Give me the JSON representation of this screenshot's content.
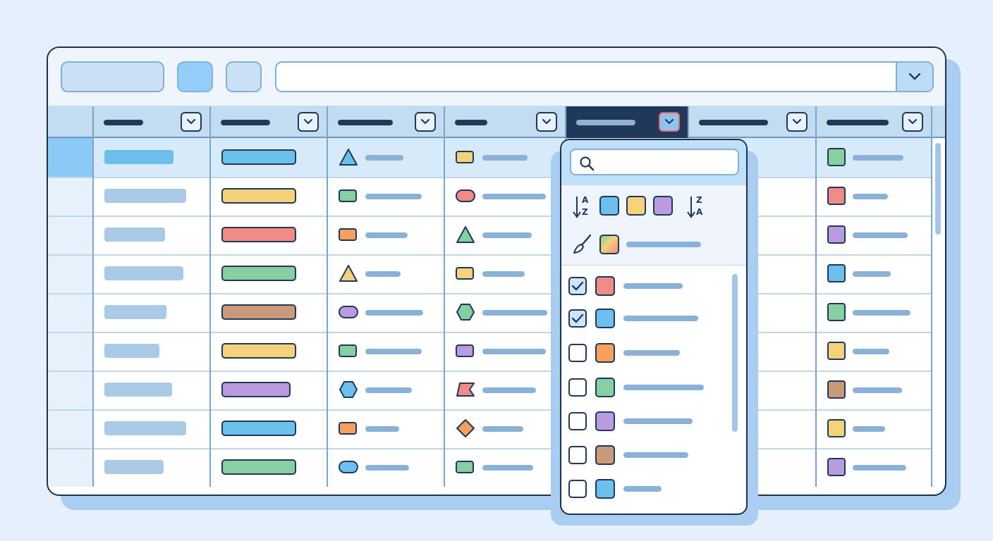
{
  "toolbar": {
    "buttons": [
      {
        "name": "toolbar-button-1"
      },
      {
        "name": "toolbar-button-2"
      },
      {
        "name": "toolbar-button-3"
      }
    ],
    "search_icon": "chevron-down-icon"
  },
  "columns": [
    {
      "name": "column-1",
      "dropdown_icon": "chevron-down-icon"
    },
    {
      "name": "column-2",
      "dropdown_icon": "chevron-down-icon"
    },
    {
      "name": "column-3",
      "dropdown_icon": "chevron-down-icon"
    },
    {
      "name": "column-4",
      "dropdown_icon": "chevron-down-icon"
    },
    {
      "name": "column-5",
      "dropdown_icon": "chevron-down-icon",
      "active": true
    },
    {
      "name": "column-6",
      "dropdown_icon": "chevron-down-icon"
    },
    {
      "name": "column-7",
      "dropdown_icon": "chevron-down-icon"
    }
  ],
  "colors": {
    "red": "#f08a86",
    "yellow": "#f4d27a",
    "green": "#86cfa3",
    "brown": "#c99a78",
    "purple": "#b99be0",
    "blue": "#6cc0ec",
    "orange": "#f8a05e",
    "selected_row": "#d6eaf9",
    "active_header": "#22385a",
    "accent": "#8ccaf5"
  },
  "rows": [
    {
      "selected": true,
      "tag": "blue",
      "c3": {
        "shape": "triangle",
        "color": "blue"
      },
      "c4": {
        "shape": "square",
        "color": "yellow"
      },
      "c7": "green"
    },
    {
      "selected": false,
      "tag": "yellow",
      "c3": {
        "shape": "square",
        "color": "green"
      },
      "c4": {
        "shape": "pill",
        "color": "red"
      },
      "c7": "red"
    },
    {
      "selected": false,
      "tag": "red",
      "c3": {
        "shape": "square",
        "color": "orange"
      },
      "c4": {
        "shape": "triangle",
        "color": "green"
      },
      "c7": "purple"
    },
    {
      "selected": false,
      "tag": "green",
      "c3": {
        "shape": "triangle",
        "color": "yellow"
      },
      "c4": {
        "shape": "square",
        "color": "yellow"
      },
      "c7": "blue"
    },
    {
      "selected": false,
      "tag": "brown",
      "c3": {
        "shape": "pill",
        "color": "purple"
      },
      "c4": {
        "shape": "hexagon",
        "color": "green"
      },
      "c7": "green"
    },
    {
      "selected": false,
      "tag": "yellow",
      "c3": {
        "shape": "square",
        "color": "green"
      },
      "c4": {
        "shape": "square",
        "color": "purple"
      },
      "c7": "yellow"
    },
    {
      "selected": false,
      "tag": "purple",
      "c3": {
        "shape": "hexagon",
        "color": "blue"
      },
      "c4": {
        "shape": "flag",
        "color": "red"
      },
      "c7": "brown"
    },
    {
      "selected": false,
      "tag": "blue",
      "c3": {
        "shape": "square",
        "color": "orange"
      },
      "c4": {
        "shape": "diamond",
        "color": "orange"
      },
      "c7": "yellow"
    },
    {
      "selected": false,
      "tag": "green",
      "c3": {
        "shape": "pill",
        "color": "blue"
      },
      "c4": {
        "shape": "square",
        "color": "green"
      },
      "c7": "purple"
    }
  ],
  "filter_popup": {
    "search_icon": "search-icon",
    "sort_ascending_icon": "sort-a-z-icon",
    "sort_descending_icon": "sort-z-a-icon",
    "sort_ascending_letters": [
      "A",
      "Z"
    ],
    "sort_descending_letters": [
      "Z",
      "A"
    ],
    "color_swatches": [
      "blue",
      "yellow",
      "purple"
    ],
    "brush_icon": "paint-brush-icon",
    "multi_color_icon": "color-palette-icon",
    "items": [
      {
        "checked": true,
        "color": "red"
      },
      {
        "checked": true,
        "color": "blue"
      },
      {
        "checked": false,
        "color": "orange"
      },
      {
        "checked": false,
        "color": "green"
      },
      {
        "checked": false,
        "color": "purple"
      },
      {
        "checked": false,
        "color": "brown"
      },
      {
        "checked": false,
        "color": "blue"
      }
    ]
  }
}
